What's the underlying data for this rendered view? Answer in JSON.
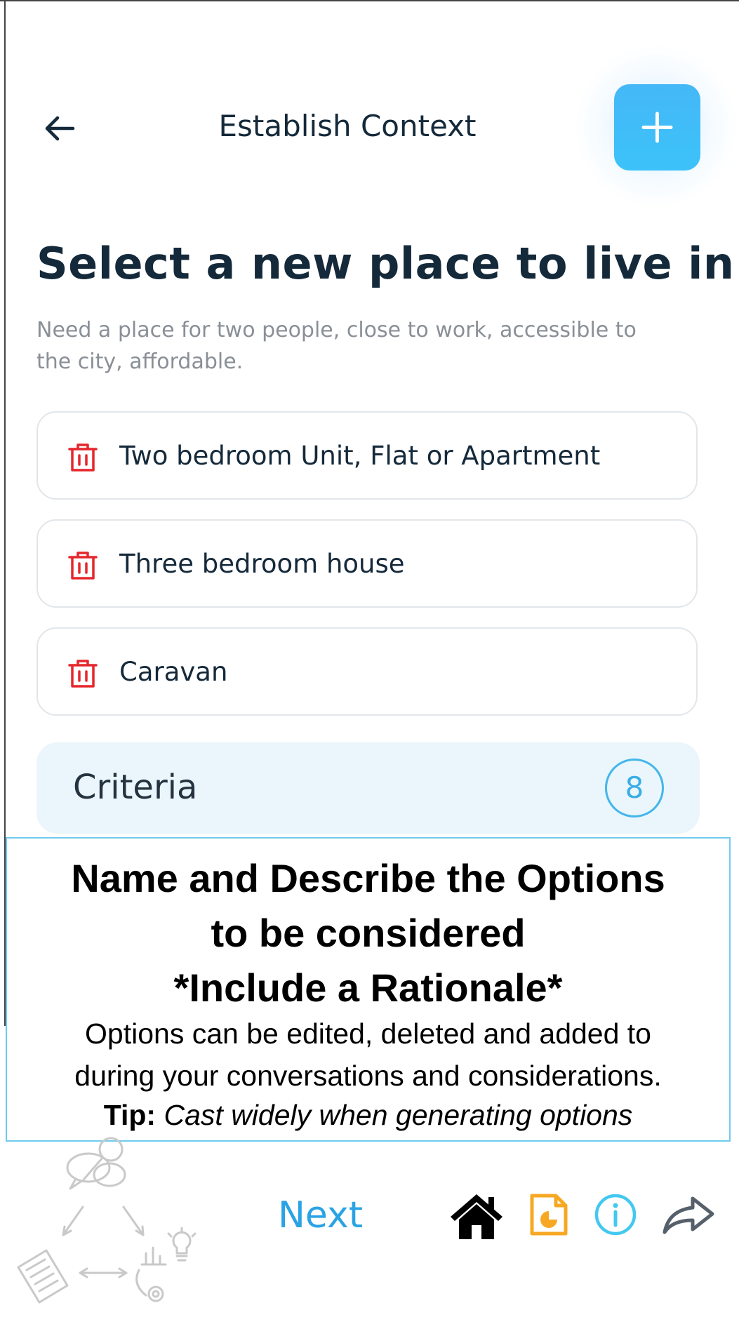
{
  "header": {
    "title": "Establish Context"
  },
  "main": {
    "title": "Select a new place to live in",
    "description": "Need a place for two people, close to work, accessible to the city, affordable.",
    "options": [
      {
        "label": "Two bedroom Unit, Flat or Apartment"
      },
      {
        "label": "Three bedroom house"
      },
      {
        "label": "Caravan"
      }
    ],
    "criteria": {
      "label": "Criteria",
      "count": "8"
    }
  },
  "help": {
    "title_line1": "Name and Describe the Options",
    "title_line2": "to be considered",
    "title_line3": "*Include a Rationale*",
    "text_line1": "Options can be edited, deleted and added to",
    "text_line2": "during your conversations and considerations.",
    "tip_label": "Tip:",
    "tip_text": "Cast widely when generating options"
  },
  "footer": {
    "next_label": "Next"
  },
  "colors": {
    "accent": "#3cb8f5",
    "delete": "#e5262c",
    "doc_icon": "#f7a823",
    "info_icon": "#43c8f0"
  },
  "icons": [
    "back-arrow-icon",
    "plus-icon",
    "trash-icon",
    "home-icon",
    "document-icon",
    "info-icon",
    "share-arrow-icon"
  ]
}
